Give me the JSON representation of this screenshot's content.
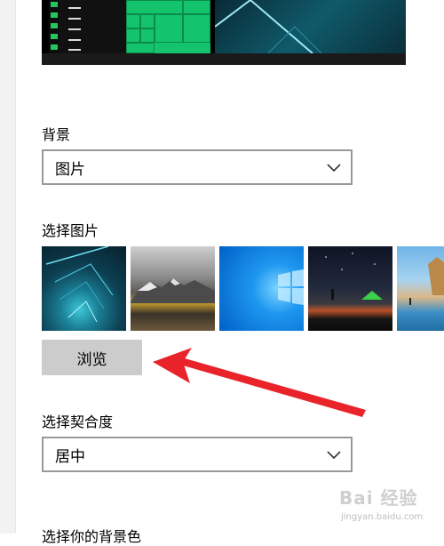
{
  "background_section": {
    "label": "背景",
    "selected": "图片"
  },
  "choose_picture": {
    "label": "选择图片",
    "thumbnails": [
      "tunnel-thumbnail",
      "mountains-thumbnail",
      "windows-thumbnail",
      "night-sky-thumbnail",
      "beach-thumbnail"
    ],
    "browse_label": "浏览"
  },
  "fit_section": {
    "label": "选择契合度",
    "selected": "居中"
  },
  "next_section": {
    "label": "选择你的背景色"
  },
  "watermark": {
    "main": "Bai 经验",
    "sub": "jingyan.baidu.com"
  },
  "colors": {
    "accent_arrow": "#e8232a",
    "button_bg": "#cccccc",
    "dropdown_border": "#999999"
  }
}
